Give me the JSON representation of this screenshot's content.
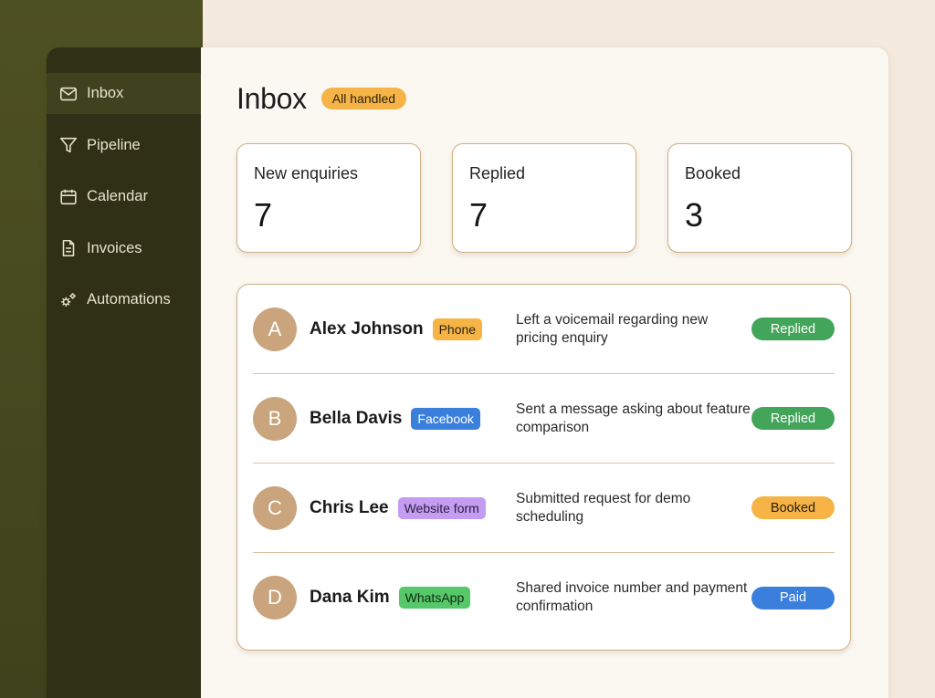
{
  "sidebar": {
    "items": [
      {
        "label": "Inbox",
        "icon": "mail-icon",
        "active": true
      },
      {
        "label": "Pipeline",
        "icon": "filter-icon",
        "active": false
      },
      {
        "label": "Calendar",
        "icon": "calendar-icon",
        "active": false
      },
      {
        "label": "Invoices",
        "icon": "document-icon",
        "active": false
      },
      {
        "label": "Automations",
        "icon": "gears-icon",
        "active": false
      }
    ]
  },
  "header": {
    "title": "Inbox",
    "status": "All handled"
  },
  "stats": [
    {
      "label": "New enquiries",
      "value": "7"
    },
    {
      "label": "Replied",
      "value": "7"
    },
    {
      "label": "Booked",
      "value": "3"
    }
  ],
  "enquiries": [
    {
      "initial": "A",
      "name": "Alex Johnson",
      "channel": "Phone",
      "message": "Left a voicemail regarding new pricing enquiry",
      "status": "Replied"
    },
    {
      "initial": "B",
      "name": "Bella Davis",
      "channel": "Facebook",
      "message": "Sent a message asking about feature comparison",
      "status": "Replied"
    },
    {
      "initial": "C",
      "name": "Chris Lee",
      "channel": "Website form",
      "message": "Submitted request for demo scheduling",
      "status": "Booked"
    },
    {
      "initial": "D",
      "name": "Dana Kim",
      "channel": "WhatsApp",
      "message": "Shared invoice number and payment confirmation",
      "status": "Paid"
    }
  ],
  "colors": {
    "channel_phone": "#f6b447",
    "channel_facebook": "#3a7fdc",
    "channel_website_form": "#c49cf2",
    "channel_whatsapp": "#56c86a",
    "status_replied": "#43a55a",
    "status_booked": "#f6b447",
    "status_paid": "#3a7fdc",
    "sidebar_bg": "#2f3015",
    "accent_pill": "#f6b447"
  }
}
